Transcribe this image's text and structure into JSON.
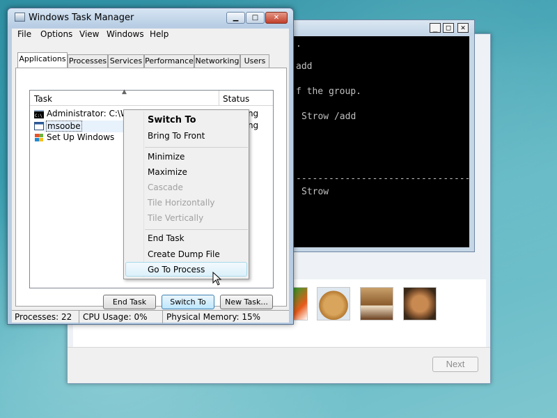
{
  "task_manager": {
    "title": "Windows Task Manager",
    "menu": [
      "File",
      "Options",
      "View",
      "Windows",
      "Help"
    ],
    "tabs": [
      "Applications",
      "Processes",
      "Services",
      "Performance",
      "Networking",
      "Users"
    ],
    "active_tab": "Applications",
    "columns": {
      "task": "Task",
      "status": "Status"
    },
    "tasks": [
      {
        "name": "Administrator: C:\\Windows\\system32\\cmd.exe",
        "status": "Running",
        "icon": "cmd-icon"
      },
      {
        "name": "msoobe",
        "status": "Running",
        "icon": "window-icon"
      },
      {
        "name": "Set Up Windows",
        "status": "",
        "icon": "windows-logo-icon"
      }
    ],
    "buttons": {
      "end_task": "End Task",
      "switch_to": "Switch To",
      "new_task": "New Task..."
    },
    "status": {
      "processes": "Processes: 22",
      "cpu": "CPU Usage: 0%",
      "memory": "Physical Memory: 15%"
    }
  },
  "context_menu": {
    "switch_to": "Switch To",
    "bring_to_front": "Bring To Front",
    "minimize": "Minimize",
    "maximize": "Maximize",
    "cascade": "Cascade",
    "tile_horizontally": "Tile Horizontally",
    "tile_vertically": "Tile Vertically",
    "end_task": "End Task",
    "create_dump_file": "Create Dump File",
    "go_to_process": "Go To Process"
  },
  "console": {
    "lines": [
      ".",
      "add",
      "f the group.",
      "Strow /add",
      "--------------------------------",
      "Strow"
    ]
  },
  "setup": {
    "next_label": "Next"
  },
  "colors": {
    "console_bg": "#000000",
    "titlebar": "#c2d4e6",
    "selection": "#dcf0fa"
  }
}
